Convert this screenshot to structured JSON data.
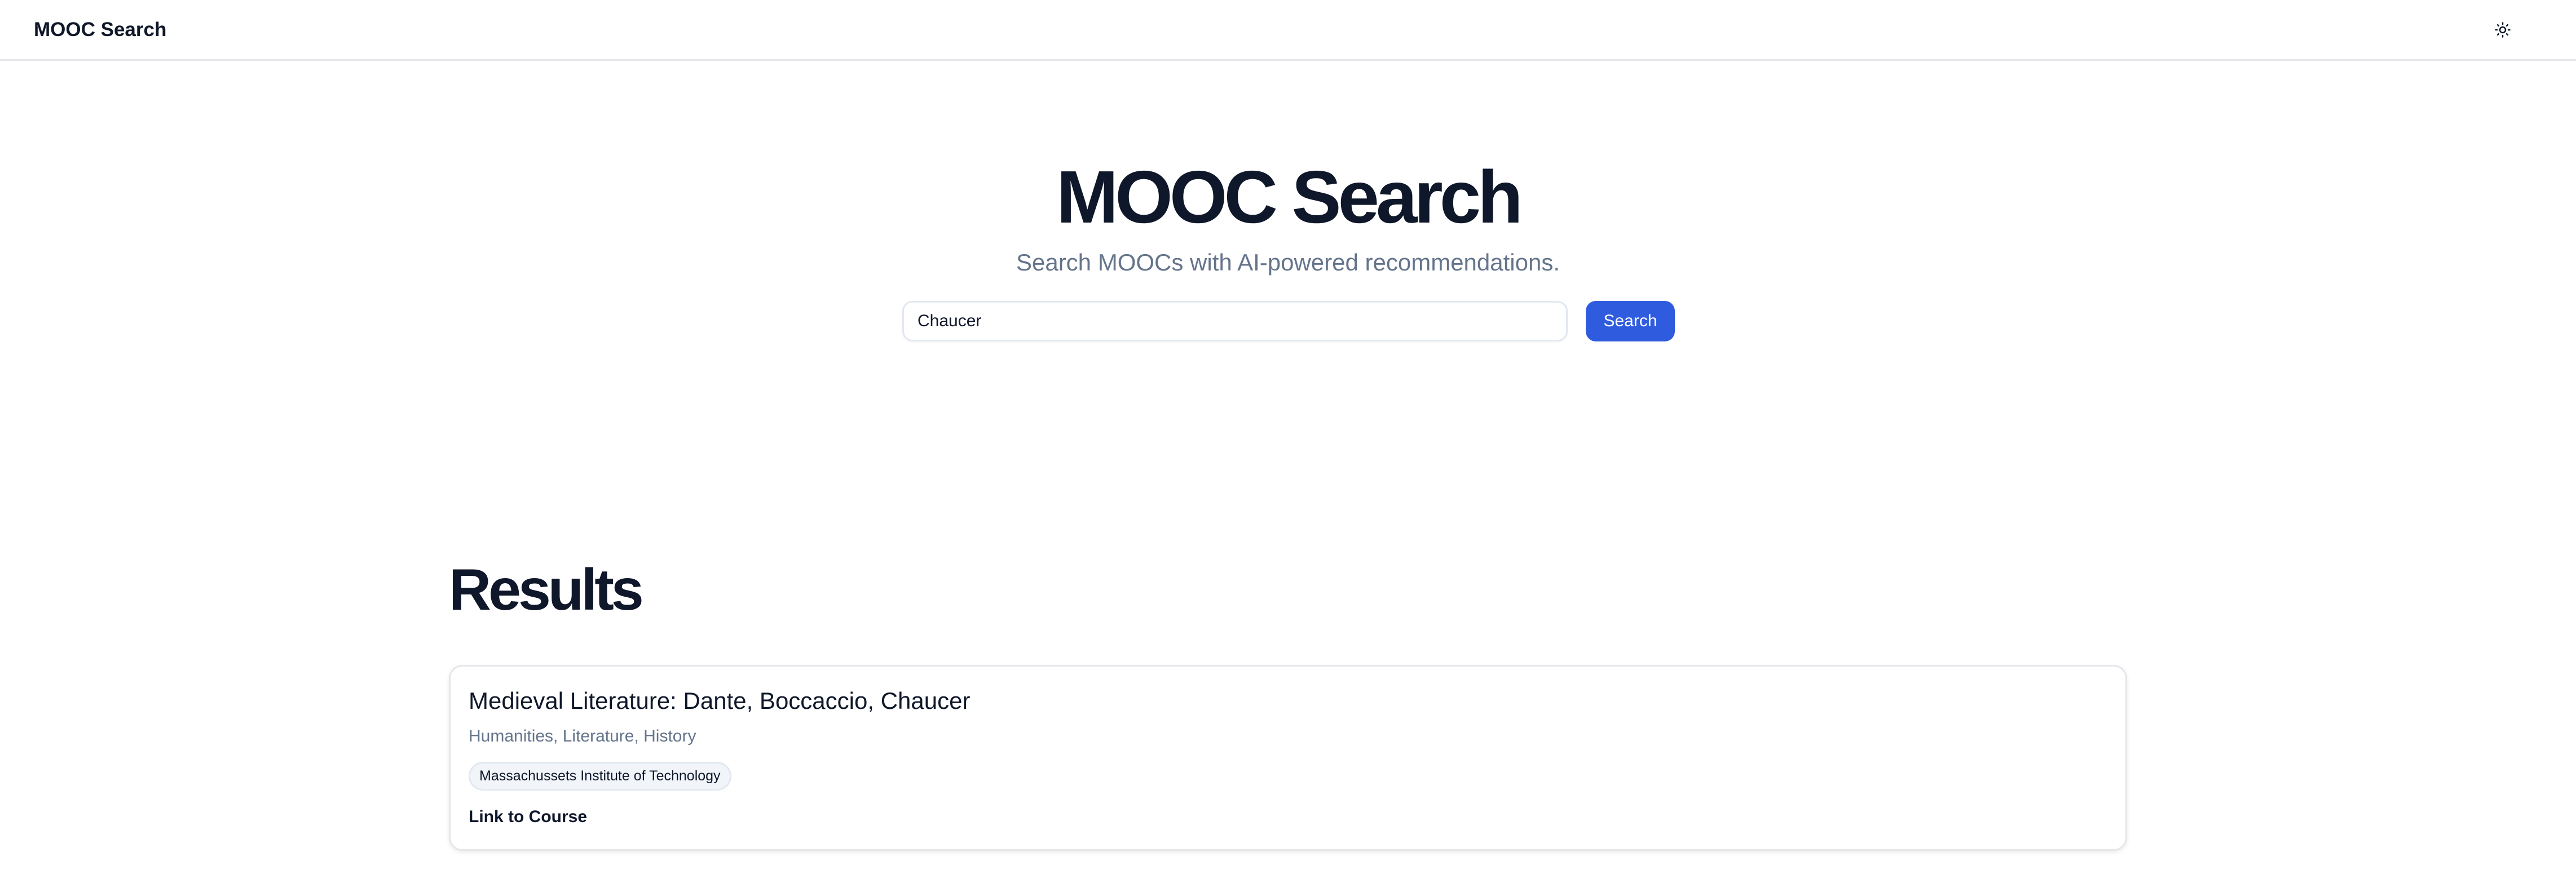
{
  "navbar": {
    "brand": "MOOC Search",
    "theme_toggle_icon": "sun-icon"
  },
  "hero": {
    "title": "MOOC Search",
    "subtitle": "Search MOOCs with AI-powered recommendations."
  },
  "search": {
    "value": "Chaucer",
    "button_label": "Search"
  },
  "results": {
    "heading": "Results",
    "items": [
      {
        "title": "Medieval Literature: Dante, Boccaccio, Chaucer",
        "categories": "Humanities, Literature, History",
        "institution": "Massachussets Institute of Technology",
        "link_label": "Link to Course"
      }
    ]
  },
  "colors": {
    "accent": "#2f5bdf",
    "muted_text": "#64748b",
    "text": "#0f172a"
  }
}
